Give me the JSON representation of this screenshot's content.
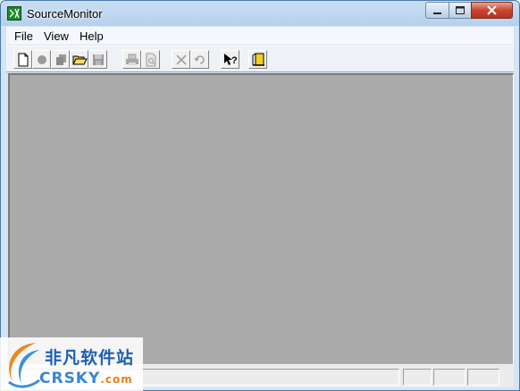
{
  "window": {
    "title": "SourceMonitor",
    "icon": "sourcemonitor-app-icon"
  },
  "menubar": {
    "items": [
      {
        "label": "File"
      },
      {
        "label": "View"
      },
      {
        "label": "Help"
      }
    ]
  },
  "toolbar": {
    "buttons": [
      {
        "icon": "new-document-icon",
        "enabled": true
      },
      {
        "icon": "circle-icon",
        "enabled": false
      },
      {
        "icon": "stack-icon",
        "enabled": false
      },
      {
        "icon": "open-folder-icon",
        "enabled": true
      },
      {
        "icon": "save-icon",
        "enabled": false
      },
      {
        "icon": "print-icon",
        "enabled": false
      },
      {
        "icon": "print-preview-icon",
        "enabled": false
      },
      {
        "icon": "delete-icon",
        "enabled": false
      },
      {
        "icon": "refresh-icon",
        "enabled": false
      },
      {
        "icon": "context-help-icon",
        "enabled": true
      },
      {
        "icon": "exit-door-icon",
        "enabled": true
      }
    ]
  },
  "watermark": {
    "name_cn": "非凡软件站",
    "name_en": "CRSKY",
    "domain_suffix": ".com"
  },
  "colors": {
    "client_area": "#ababab",
    "title_gradient_top": "#c9def4",
    "close_button": "#c9452f"
  }
}
